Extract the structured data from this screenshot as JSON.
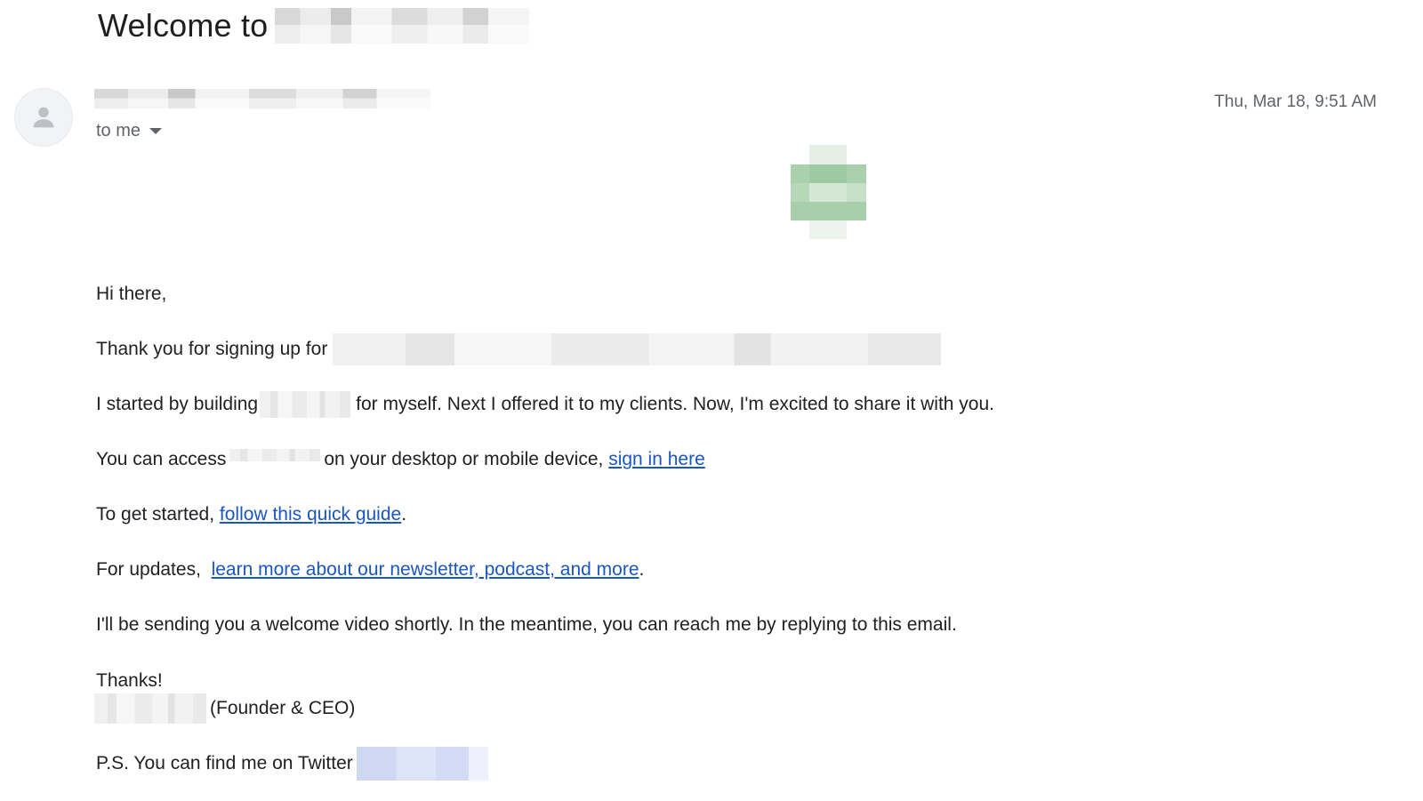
{
  "email": {
    "subject": "Welcome to",
    "to_label": "to me",
    "timestamp": "Thu, Mar 18, 9:51 AM"
  },
  "icons": {
    "avatar": "person-icon",
    "recipients_toggle": "caret-down-icon",
    "logo": "company-logo"
  },
  "colors": {
    "link": "#1a56c4",
    "logo_green": "#a9d1ad"
  },
  "body": {
    "greeting": "Hi there,",
    "line1_prefix": "Thank you for signing up for",
    "line2_prefix": "I started by building",
    "line2_suffix": "for myself. Next I offered it to my clients. Now, I'm excited to share it with you.",
    "line3_prefix": "You can access",
    "line3_middle": "on your desktop or mobile device,",
    "line3_link": "sign in here",
    "line4_prefix": "To get started,",
    "line4_link": "follow this quick guide",
    "line4_suffix": ".",
    "line5_prefix": "For updates,",
    "line5_link": "learn more about our newsletter, podcast, and more",
    "line5_suffix": ".",
    "line6": "I'll be sending you a welcome video shortly. In the meantime, you can reach me by replying to this email.",
    "signoff": "Thanks!",
    "signature_title": "(Founder & CEO)",
    "ps_prefix": "P.S. You can find me on Twitter"
  }
}
